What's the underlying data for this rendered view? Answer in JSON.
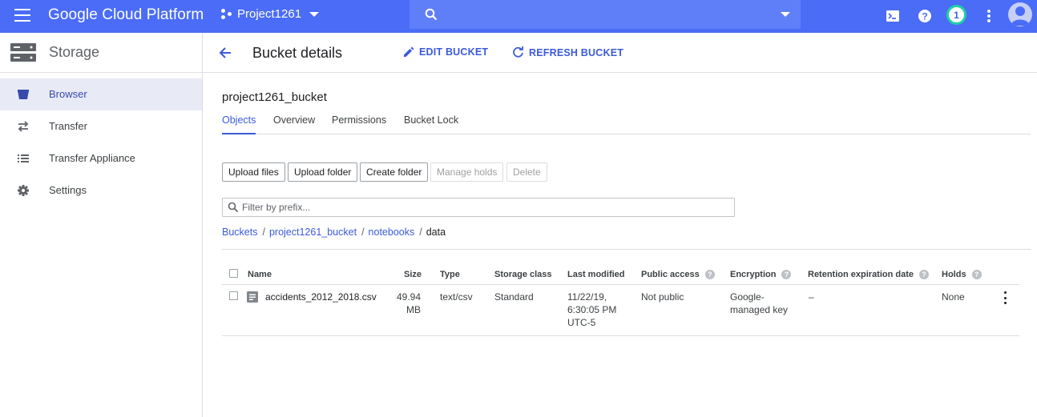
{
  "topbar": {
    "brand": "Google Cloud Platform",
    "project": "Project1261",
    "notifications_count": "1",
    "colors": {
      "bar": "#4a6cf7",
      "search": "#5f7ff8",
      "badge_ring": "#1fcfa6"
    }
  },
  "sidebar": {
    "title": "Storage",
    "items": [
      {
        "label": "Browser",
        "icon": "bucket-icon",
        "active": true
      },
      {
        "label": "Transfer",
        "icon": "transfer-arrows-icon",
        "active": false
      },
      {
        "label": "Transfer Appliance",
        "icon": "list-icon",
        "active": false
      },
      {
        "label": "Settings",
        "icon": "gear-icon",
        "active": false
      }
    ]
  },
  "header": {
    "title": "Bucket details",
    "edit_label": "EDIT BUCKET",
    "refresh_label": "REFRESH BUCKET"
  },
  "bucket": {
    "name": "project1261_bucket",
    "tabs": [
      "Objects",
      "Overview",
      "Permissions",
      "Bucket Lock"
    ],
    "active_tab": "Objects"
  },
  "actions": {
    "upload_files": "Upload files",
    "upload_folder": "Upload folder",
    "create_folder": "Create folder",
    "manage_holds": "Manage holds",
    "delete": "Delete"
  },
  "filter": {
    "placeholder": "Filter by prefix..."
  },
  "breadcrumb": {
    "items": [
      "Buckets",
      "project1261_bucket",
      "notebooks"
    ],
    "current": "data"
  },
  "table": {
    "columns": {
      "name": "Name",
      "size": "Size",
      "type": "Type",
      "storage_class": "Storage class",
      "last_modified": "Last modified",
      "public_access": "Public access",
      "encryption": "Encryption",
      "retention": "Retention expiration date",
      "holds": "Holds"
    },
    "rows": [
      {
        "name": "accidents_2012_2018.csv",
        "size_line1": "49.94",
        "size_line2": "MB",
        "type": "text/csv",
        "storage_class": "Standard",
        "modified_line1": "11/22/19,",
        "modified_line2": "6:30:05 PM",
        "modified_line3": "UTC-5",
        "public_access": "Not public",
        "encryption_line1": "Google-",
        "encryption_line2": "managed key",
        "retention": "–",
        "holds": "None"
      }
    ]
  }
}
